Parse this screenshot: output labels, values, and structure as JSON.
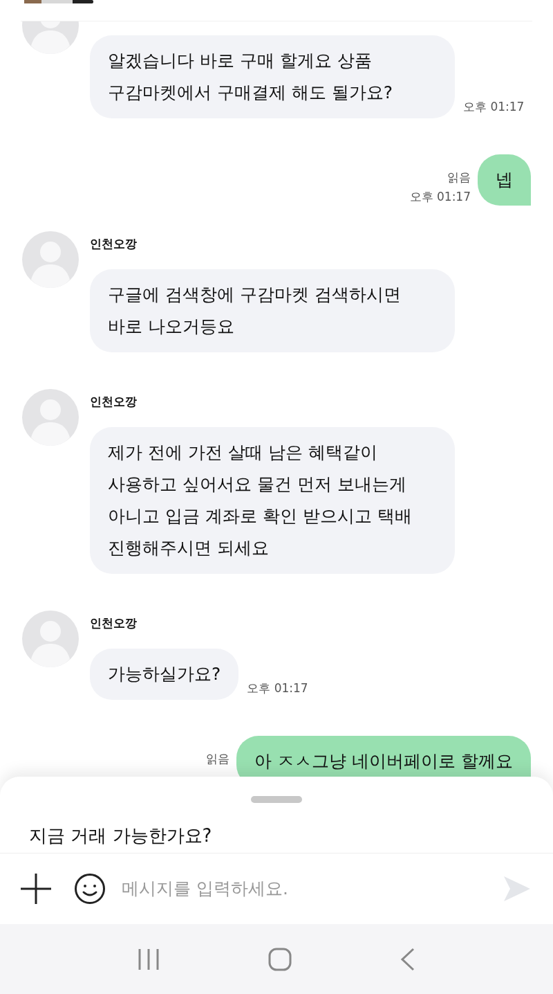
{
  "messages": [
    {
      "kind": "received",
      "lines": [
        "알겠습니다 바로 구매 할게요 상품",
        "구감마켓에서 구매결제 해도 될가요?"
      ],
      "time": "오후 01:17"
    },
    {
      "kind": "sent",
      "lines": [
        "넵"
      ],
      "read": "읽음",
      "time": "오후 01:17"
    },
    {
      "kind": "received",
      "sender": "인천오깡",
      "lines": [
        "구글에 검색창에 구감마켓 검색하시면",
        "바로 나오거등요"
      ]
    },
    {
      "kind": "received",
      "sender": "인천오깡",
      "lines": [
        "제가 전에 가전 살때 남은 혜택같이",
        "사용하고 싶어서요 물건 먼저 보내는게",
        "아니고 입금 계좌로 확인 받으시고 택배",
        "진행해주시면 되세요"
      ]
    },
    {
      "kind": "received",
      "sender": "인천오깡",
      "lines": [
        "가능하실가요?"
      ],
      "time": "오후 01:17"
    },
    {
      "kind": "sent",
      "lines": [
        "아 ㅈㅅ그냥 네이버페이로 할께요"
      ],
      "read": "읽음"
    }
  ],
  "suggestion_sheet": {
    "text": "지금 거래 가능한가요?"
  },
  "composer": {
    "placeholder": "메시지를 입력하세요."
  }
}
